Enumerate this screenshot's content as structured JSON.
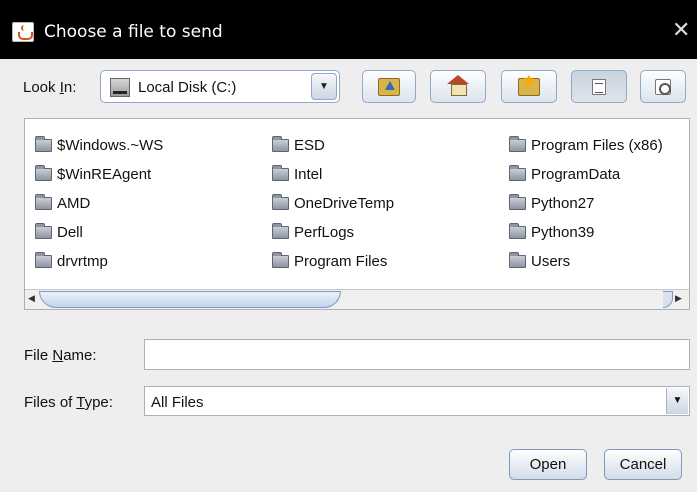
{
  "window": {
    "title": "Choose a file to send",
    "close_glyph": "✕"
  },
  "look_in": {
    "label_prefix": "Look ",
    "label_mnemonic": "I",
    "label_suffix": "n:",
    "selected": "Local Disk (C:)",
    "drive_icon": "hard-drive-icon"
  },
  "toolbar": {
    "buttons": [
      {
        "name": "up-one-level",
        "icon": "folder-up-icon"
      },
      {
        "name": "home",
        "icon": "home-icon"
      },
      {
        "name": "create-new-folder",
        "icon": "new-folder-icon"
      },
      {
        "name": "list-view",
        "icon": "list-view-icon",
        "pressed": true
      },
      {
        "name": "details-view",
        "icon": "details-view-icon"
      }
    ]
  },
  "files": {
    "columns": [
      [
        "$Windows.~WS",
        "$WinREAgent",
        "AMD",
        "Dell",
        "drvrtmp"
      ],
      [
        "ESD",
        "Intel",
        "OneDriveTemp",
        "PerfLogs",
        "Program Files"
      ],
      [
        "Program Files (x86)",
        "ProgramData",
        "Python27",
        "Python39",
        "Users"
      ]
    ]
  },
  "file_name": {
    "label_prefix": "File ",
    "label_mnemonic": "N",
    "label_suffix": "ame:",
    "value": ""
  },
  "file_type": {
    "label_prefix": "Files of ",
    "label_mnemonic": "T",
    "label_suffix": "ype:",
    "selected": "All Files"
  },
  "actions": {
    "open_label": "Open",
    "cancel_label": "Cancel"
  },
  "colors": {
    "titlebar": "#000000",
    "window_bg": "#eeeeee",
    "button_border": "#7f98bc"
  }
}
